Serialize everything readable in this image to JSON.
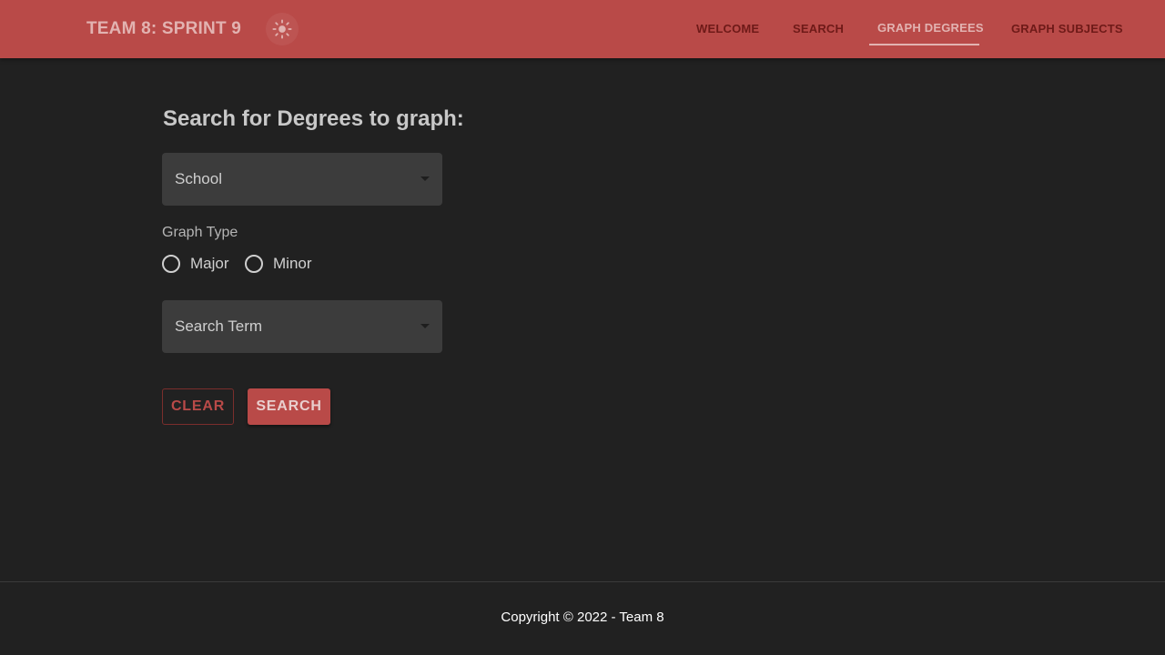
{
  "header": {
    "title": "TEAM 8: SPRINT 9",
    "theme_toggle_icon": "sun-icon",
    "nav": [
      {
        "label": "WELCOME",
        "active": false
      },
      {
        "label": "SEARCH",
        "active": false
      },
      {
        "label": "GRAPH DEGREES",
        "active": true
      },
      {
        "label": "GRAPH SUBJECTS",
        "active": false
      }
    ]
  },
  "form": {
    "heading": "Search for Degrees to graph:",
    "school_select": {
      "label": "School"
    },
    "graph_type": {
      "label": "Graph Type",
      "options": [
        "Major",
        "Minor"
      ]
    },
    "search_term_select": {
      "label": "Search Term"
    },
    "clear_label": "CLEAR",
    "search_label": "SEARCH"
  },
  "footer": {
    "text": "Copyright © 2022 - Team 8"
  },
  "colors": {
    "brand": "#b94a48",
    "background": "#212121",
    "field": "#3c3c3c"
  }
}
